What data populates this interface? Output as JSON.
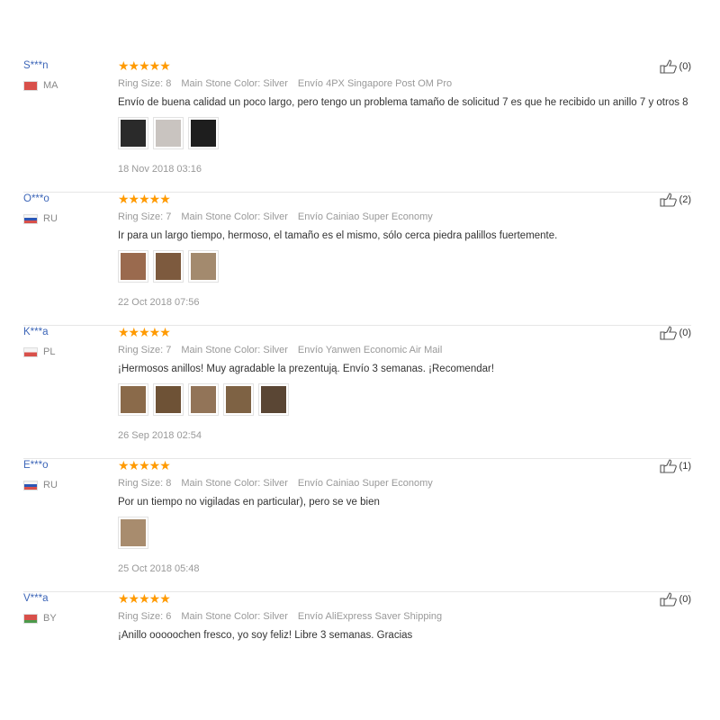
{
  "reviews": [
    {
      "user": "S***n",
      "country": "MA",
      "stars": "★★★★★",
      "ring_size": "Ring Size: 8",
      "stone_color": "Main Stone Color: Silver",
      "shipping": "Envío 4PX Singapore Post OM Pro",
      "text": "Envío de buena calidad un poco largo, pero tengo un problema tamaño de solicitud 7 es que he recibido un anillo 7 y otros 8",
      "photo_colors": [
        "#2a2a2a",
        "#c9c4c0",
        "#1e1e1e"
      ],
      "date": "18 Nov 2018 03:16",
      "helpful": "(0)"
    },
    {
      "user": "O***o",
      "country": "RU",
      "stars": "★★★★★",
      "ring_size": "Ring Size: 7",
      "stone_color": "Main Stone Color: Silver",
      "shipping": "Envío Cainiao Super Economy",
      "text": "Ir para un largo tiempo, hermoso, el tamaño es el mismo, sólo cerca piedra palillos fuertemente.",
      "photo_colors": [
        "#9a6a4e",
        "#7d5a3e",
        "#a38a6e"
      ],
      "date": "22 Oct 2018 07:56",
      "helpful": "(2)"
    },
    {
      "user": "K***a",
      "country": "PL",
      "stars": "★★★★★",
      "ring_size": "Ring Size: 7",
      "stone_color": "Main Stone Color: Silver",
      "shipping": "Envío Yanwen Economic Air Mail",
      "text": "¡Hermosos anillos! Muy agradable la prezentują. Envío 3 semanas. ¡Recomendar!",
      "photo_colors": [
        "#8a6a4a",
        "#6e5236",
        "#927458",
        "#7e6244",
        "#5a4634"
      ],
      "date": "26 Sep 2018 02:54",
      "helpful": "(0)"
    },
    {
      "user": "E***o",
      "country": "RU",
      "stars": "★★★★★",
      "ring_size": "Ring Size: 8",
      "stone_color": "Main Stone Color: Silver",
      "shipping": "Envío Cainiao Super Economy",
      "text": "Por un tiempo no vigiladas en particular), pero se ve bien",
      "photo_colors": [
        "#a88c6e"
      ],
      "date": "25 Oct 2018 05:48",
      "helpful": "(1)"
    },
    {
      "user": "V***a",
      "country": "BY",
      "stars": "★★★★★",
      "ring_size": "Ring Size: 6",
      "stone_color": "Main Stone Color: Silver",
      "shipping": "Envío AliExpress Saver Shipping",
      "text": "¡Anillo ooooochen fresco, yo soy feliz! Libre 3 semanas. Gracias",
      "photo_colors": [],
      "date": "",
      "helpful": "(0)"
    }
  ]
}
